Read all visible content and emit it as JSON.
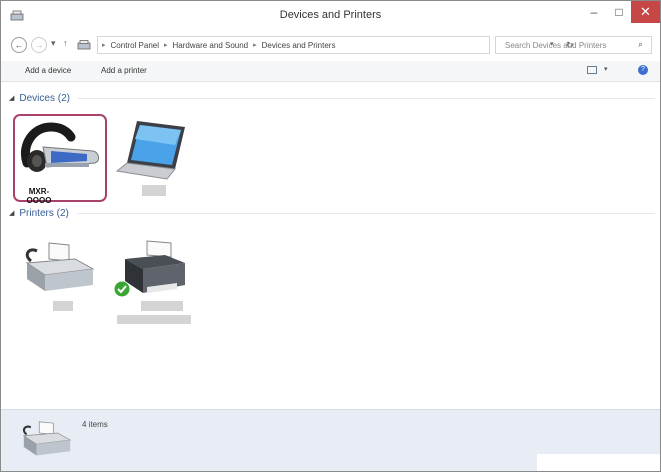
{
  "window": {
    "title": "Devices and Printers"
  },
  "title_controls": {
    "minimize": "–",
    "maximize": "□",
    "close": "✕"
  },
  "nav": {
    "back": "←",
    "forward": "→",
    "history": "▾",
    "up": "↑",
    "breadcrumbs": [
      "Control Panel",
      "Hardware and Sound",
      "Devices and Printers"
    ],
    "separator": "▸",
    "dropdown": "▾",
    "refresh": "↻",
    "search_placeholder": "Search Devices and Printers",
    "search_glyph": "⌕"
  },
  "commands": {
    "add_device": "Add a device",
    "add_printer": "Add a printer",
    "view_dropdown": "▾",
    "help": "?"
  },
  "groups": {
    "devices": {
      "label": "Devices (2)",
      "collapse": "◢"
    },
    "printers": {
      "label": "Printers (2)",
      "collapse": "◢"
    }
  },
  "devices": [
    {
      "name": "MXR-OOOO",
      "icon": "headset-icon",
      "selected": true
    },
    {
      "name": "",
      "icon": "laptop-icon",
      "selected": false
    }
  ],
  "printers": [
    {
      "name": "",
      "icon": "fax-icon",
      "is_default": false
    },
    {
      "name": "",
      "icon": "printer-icon",
      "is_default": true
    }
  ],
  "details": {
    "count": "4 items",
    "icon": "fax-icon"
  },
  "colors": {
    "selection_border": "#a8416c",
    "group_header": "#375f93",
    "close_button": "#c74646",
    "details_bg": "#e8edf5"
  }
}
